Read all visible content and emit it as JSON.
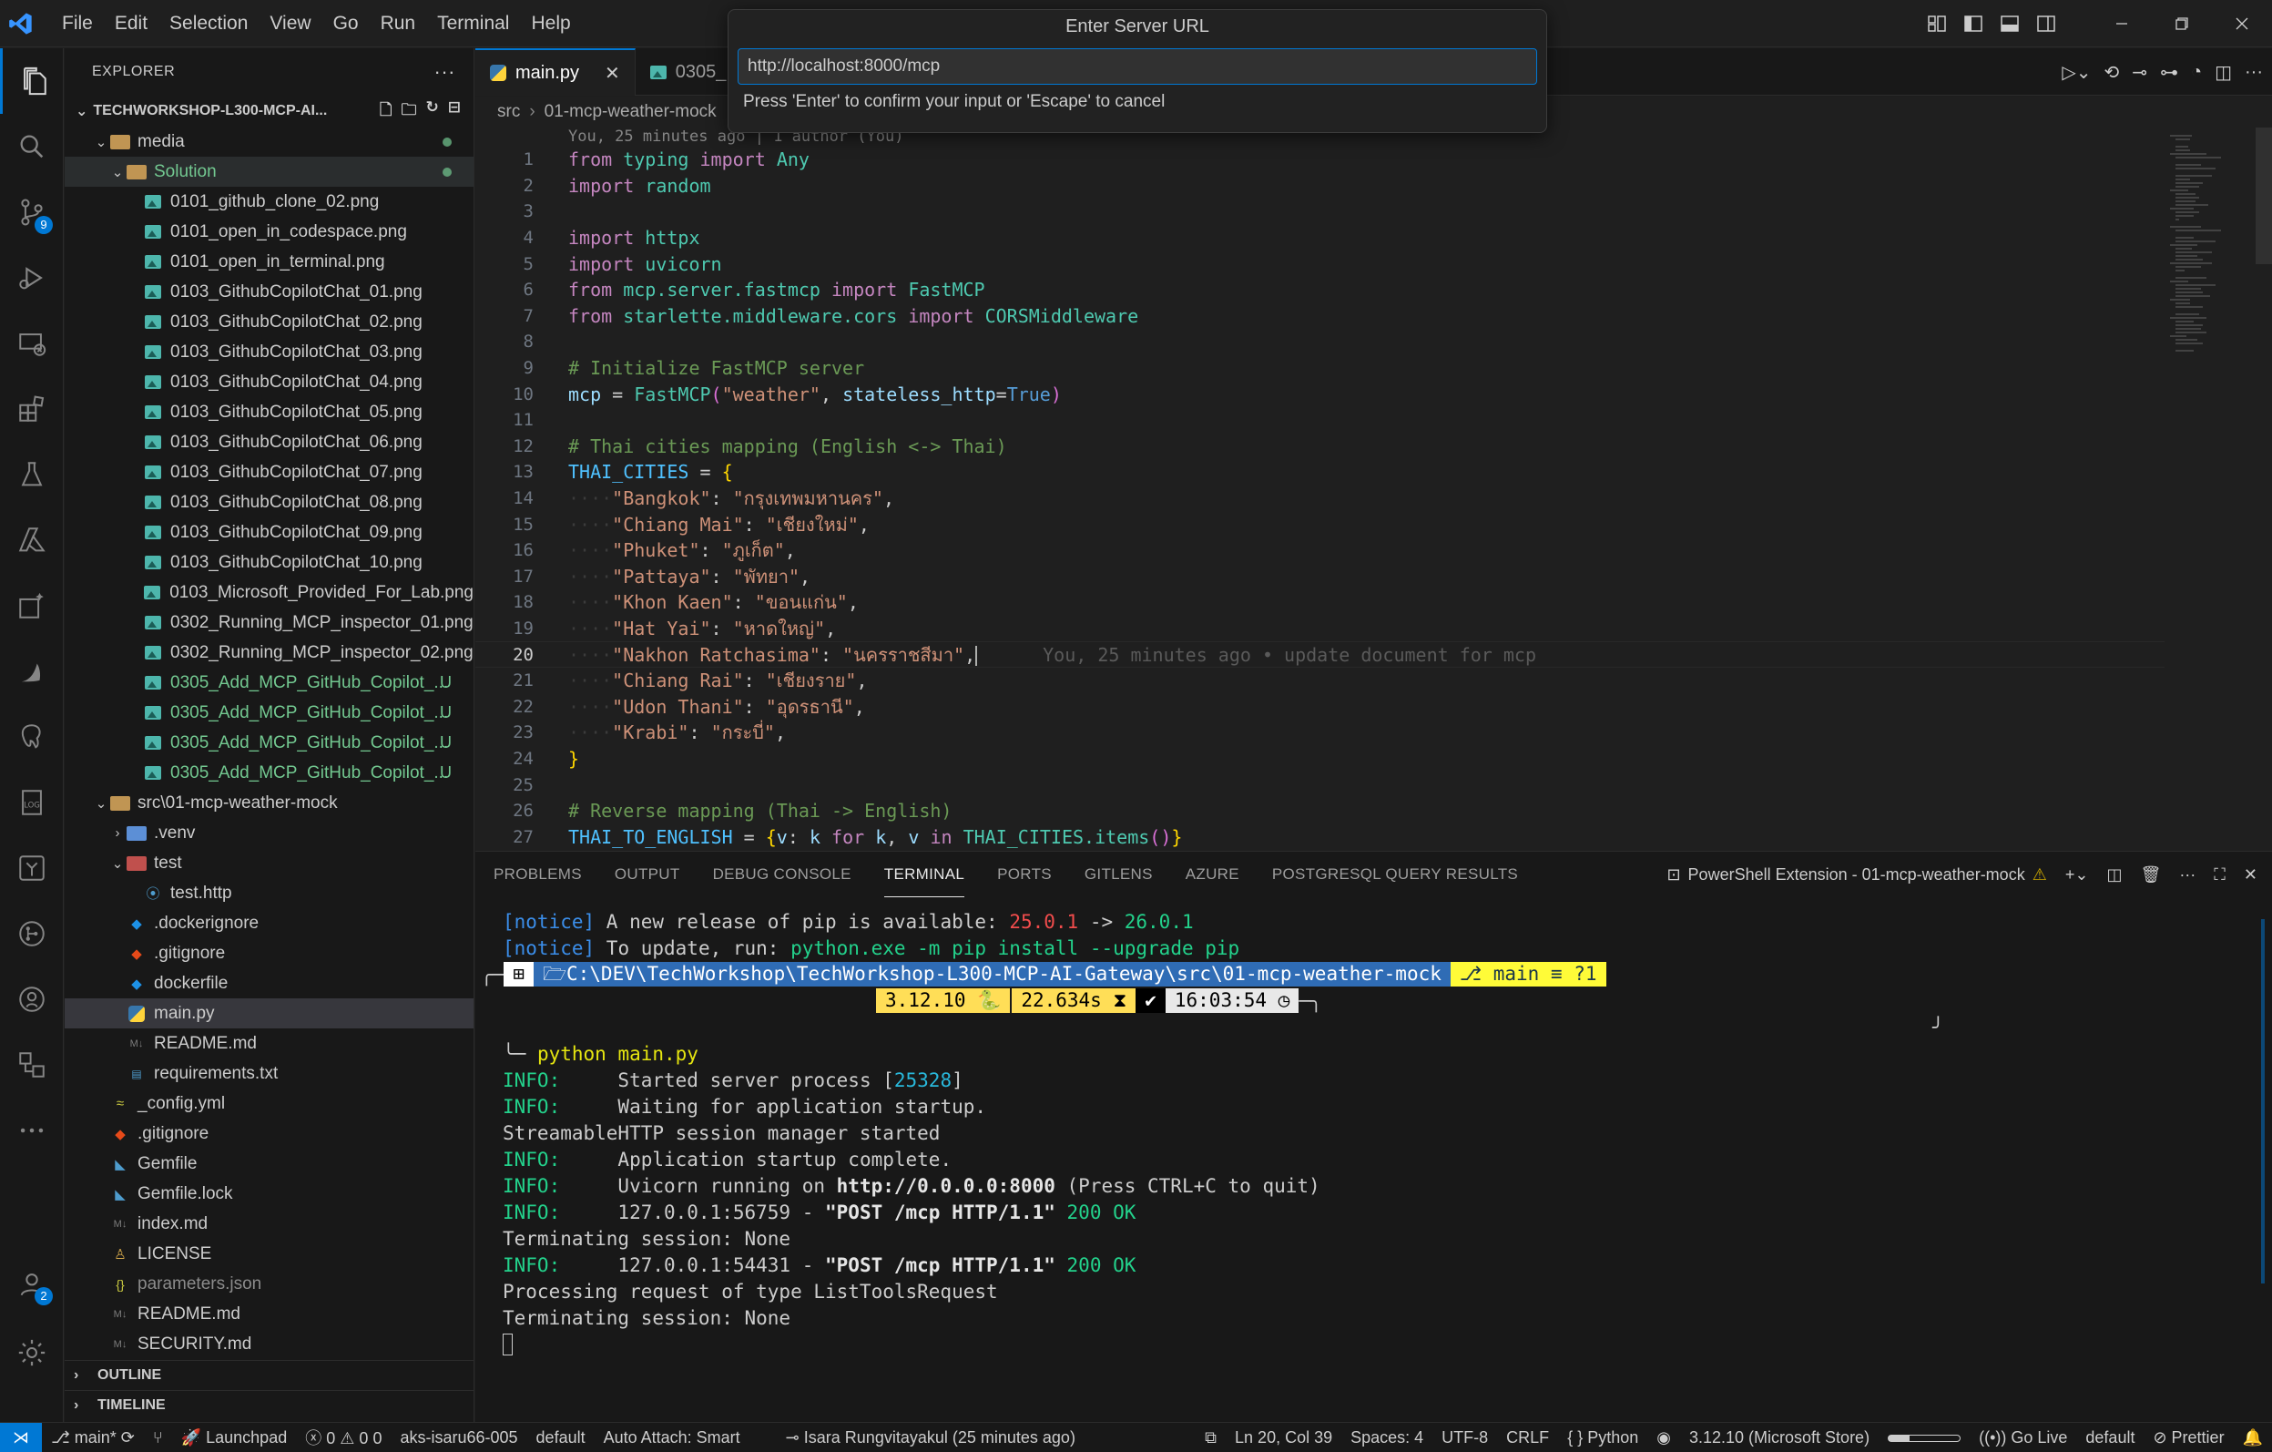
{
  "menu": [
    "File",
    "Edit",
    "Selection",
    "View",
    "Go",
    "Run",
    "Terminal",
    "Help"
  ],
  "quick_input": {
    "title": "Enter Server URL",
    "value": "http://localhost:8000/mcp",
    "hint": "Press 'Enter' to confirm your input or 'Escape' to cancel"
  },
  "activity": {
    "scm_badge": "9",
    "accounts_badge": "2"
  },
  "explorer": {
    "title": "EXPLORER",
    "project": "TECHWORKSHOP-L300-MCP-AI...",
    "items": [
      {
        "label": "media",
        "kind": "folder",
        "depth": 1,
        "open": true,
        "status": "dot"
      },
      {
        "label": "Solution",
        "kind": "folder",
        "depth": 2,
        "open": true,
        "status": "dot",
        "color": "green"
      },
      {
        "label": "0101_github_clone_02.png",
        "kind": "img",
        "depth": 3
      },
      {
        "label": "0101_open_in_codespace.png",
        "kind": "img",
        "depth": 3
      },
      {
        "label": "0101_open_in_terminal.png",
        "kind": "img",
        "depth": 3
      },
      {
        "label": "0103_GithubCopilotChat_01.png",
        "kind": "img",
        "depth": 3
      },
      {
        "label": "0103_GithubCopilotChat_02.png",
        "kind": "img",
        "depth": 3
      },
      {
        "label": "0103_GithubCopilotChat_03.png",
        "kind": "img",
        "depth": 3
      },
      {
        "label": "0103_GithubCopilotChat_04.png",
        "kind": "img",
        "depth": 3
      },
      {
        "label": "0103_GithubCopilotChat_05.png",
        "kind": "img",
        "depth": 3
      },
      {
        "label": "0103_GithubCopilotChat_06.png",
        "kind": "img",
        "depth": 3
      },
      {
        "label": "0103_GithubCopilotChat_07.png",
        "kind": "img",
        "depth": 3
      },
      {
        "label": "0103_GithubCopilotChat_08.png",
        "kind": "img",
        "depth": 3
      },
      {
        "label": "0103_GithubCopilotChat_09.png",
        "kind": "img",
        "depth": 3
      },
      {
        "label": "0103_GithubCopilotChat_10.png",
        "kind": "img",
        "depth": 3
      },
      {
        "label": "0103_Microsoft_Provided_For_Lab.png",
        "kind": "img",
        "depth": 3
      },
      {
        "label": "0302_Running_MCP_inspector_01.png",
        "kind": "img",
        "depth": 3
      },
      {
        "label": "0302_Running_MCP_inspector_02.png",
        "kind": "img",
        "depth": 3
      },
      {
        "label": "0305_Add_MCP_GitHub_Copilot_...",
        "kind": "img",
        "depth": 3,
        "status": "U",
        "color": "green"
      },
      {
        "label": "0305_Add_MCP_GitHub_Copilot_...",
        "kind": "img",
        "depth": 3,
        "status": "U",
        "color": "green"
      },
      {
        "label": "0305_Add_MCP_GitHub_Copilot_...",
        "kind": "img",
        "depth": 3,
        "status": "U",
        "color": "green"
      },
      {
        "label": "0305_Add_MCP_GitHub_Copilot_...",
        "kind": "img",
        "depth": 3,
        "status": "U",
        "color": "green"
      },
      {
        "label": "src\\01-mcp-weather-mock",
        "kind": "folder",
        "depth": 1,
        "open": true
      },
      {
        "label": ".venv",
        "kind": "folder-blue",
        "depth": 2,
        "open": false
      },
      {
        "label": "test",
        "kind": "folder-red",
        "depth": 2,
        "open": true
      },
      {
        "label": "test.http",
        "kind": "http",
        "depth": 3
      },
      {
        "label": ".dockerignore",
        "kind": "docker",
        "depth": 2
      },
      {
        "label": ".gitignore",
        "kind": "git",
        "depth": 2
      },
      {
        "label": "dockerfile",
        "kind": "docker",
        "depth": 2
      },
      {
        "label": "main.py",
        "kind": "py",
        "depth": 2,
        "selected": true
      },
      {
        "label": "README.md",
        "kind": "md",
        "depth": 2
      },
      {
        "label": "requirements.txt",
        "kind": "req",
        "depth": 2
      },
      {
        "label": "_config.yml",
        "kind": "yml",
        "depth": 1
      },
      {
        "label": ".gitignore",
        "kind": "git",
        "depth": 1
      },
      {
        "label": "Gemfile",
        "kind": "gem",
        "depth": 1
      },
      {
        "label": "Gemfile.lock",
        "kind": "gem",
        "depth": 1
      },
      {
        "label": "index.md",
        "kind": "md",
        "depth": 1
      },
      {
        "label": "LICENSE",
        "kind": "lic",
        "depth": 1
      },
      {
        "label": "parameters.json",
        "kind": "json",
        "depth": 1,
        "color": "dim"
      },
      {
        "label": "README.md",
        "kind": "md",
        "depth": 1
      },
      {
        "label": "SECURITY.md",
        "kind": "md",
        "depth": 1
      }
    ],
    "outline": "OUTLINE",
    "timeline": "TIMELINE"
  },
  "tabs": [
    {
      "label": "main.py",
      "active": true
    },
    {
      "label": "0305_",
      "active": false
    }
  ],
  "breadcrumb": [
    "src",
    "01-mcp-weather-mock"
  ],
  "editor": {
    "blame_top": "You, 25 minutes ago | 1 author (You)",
    "current_line": 20,
    "inline_blame": "You, 25 minutes ago • update document for mcp",
    "lines": [
      "from typing import Any",
      "import random",
      "",
      "import httpx",
      "import uvicorn",
      "from mcp.server.fastmcp import FastMCP",
      "from starlette.middleware.cors import CORSMiddleware",
      "",
      "# Initialize FastMCP server",
      "mcp = FastMCP(\"weather\", stateless_http=True)",
      "",
      "# Thai cities mapping (English <-> Thai)",
      "THAI_CITIES = {",
      "    \"Bangkok\": \"กรุงเทพมหานคร\",",
      "    \"Chiang Mai\": \"เชียงใหม่\",",
      "    \"Phuket\": \"ภูเก็ต\",",
      "    \"Pattaya\": \"พัทยา\",",
      "    \"Khon Kaen\": \"ขอนแก่น\",",
      "    \"Hat Yai\": \"หาดใหญ่\",",
      "    \"Nakhon Ratchasima\": \"นครราชสีมา\",",
      "    \"Chiang Rai\": \"เชียงราย\",",
      "    \"Udon Thani\": \"อุดรธานี\",",
      "    \"Krabi\": \"กระบี่\",",
      "}",
      "",
      "# Reverse mapping (Thai -> English)",
      "THAI_TO_ENGLISH = {v: k for k, v in THAI_CITIES.items()}"
    ]
  },
  "panel": {
    "tabs": [
      "PROBLEMS",
      "OUTPUT",
      "DEBUG CONSOLE",
      "TERMINAL",
      "PORTS",
      "GITLENS",
      "AZURE",
      "POSTGRESQL QUERY RESULTS"
    ],
    "active_tab": "TERMINAL",
    "terminal_name": "PowerShell Extension - 01-mcp-weather-mock"
  },
  "terminal": {
    "notice1_prefix": "[notice]",
    "notice1_text": " A new release of pip is available: ",
    "notice1_old": "25.0.1",
    "notice1_arrow": " -> ",
    "notice1_new": "26.0.1",
    "notice2_prefix": "[notice]",
    "notice2_text": " To update, run: ",
    "notice2_cmd": "python.exe -m pip install --upgrade pip",
    "prompt_path": "C:\\DEV\\TechWorkshop\\TechWorkshop-L300-MCP-AI-Gateway\\src\\01-mcp-weather-mock",
    "prompt_branch": "main ≡ ",
    "prompt_changes": "?1",
    "prompt_python": "3.12.10",
    "prompt_time_taken": "22.634s",
    "prompt_clock": "16:03:54",
    "command": "python main.py",
    "log": [
      {
        "level": "INFO:",
        "text": "     Started server process [",
        "num": "25328",
        "tail": "]"
      },
      {
        "level": "INFO:",
        "text": "     Waiting for application startup."
      },
      {
        "plain": "StreamableHTTP session manager started"
      },
      {
        "level": "INFO:",
        "text": "     Application startup complete."
      },
      {
        "level": "INFO:",
        "text": "     Uvicorn running on ",
        "bold": "http://0.0.0.0:8000",
        "tail": " (Press CTRL+C to quit)"
      },
      {
        "level": "INFO:",
        "text": "     127.0.0.1:56759 - ",
        "bold": "\"POST /mcp HTTP/1.1\"",
        "ok": " 200 OK"
      },
      {
        "plain": "Terminating session: None"
      },
      {
        "level": "INFO:",
        "text": "     127.0.0.1:54431 - ",
        "bold": "\"POST /mcp HTTP/1.1\"",
        "ok": " 200 OK"
      },
      {
        "plain": "Processing request of type ListToolsRequest"
      },
      {
        "plain": "Terminating session: None"
      }
    ]
  },
  "statusbar": {
    "branch": "main*",
    "launchpad": "Launchpad",
    "errors": "0",
    "warnings": "0",
    "info": "0",
    "cluster": "aks-isaru66-005",
    "namespace": "default",
    "auto_attach": "Auto Attach: Smart",
    "blame": "Isara Rungvitayakul (25 minutes ago)",
    "position": "Ln 20, Col 39",
    "spaces": "Spaces: 4",
    "encoding": "UTF-8",
    "eol": "CRLF",
    "language": "Python",
    "interpreter": "3.12.10 (Microsoft Store)",
    "golive": "Go Live",
    "profile": "default",
    "prettier": "Prettier"
  },
  "colors": {
    "accent": "#0078d4",
    "git_untracked": "#73c991"
  }
}
